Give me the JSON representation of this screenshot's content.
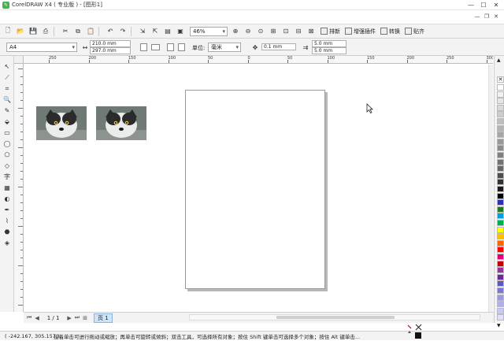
{
  "window": {
    "title": "CorelDRAW X4 ( 专业版 ) - [图形1]",
    "controls": [
      "minimize-icon",
      "maximize-icon",
      "close-icon"
    ]
  },
  "toolbar_standard": {
    "zoom_value": "46%",
    "buttons": [
      {
        "label": "排新"
      },
      {
        "label": "增强插件"
      },
      {
        "label": "转换"
      },
      {
        "label": "贴齐"
      }
    ]
  },
  "property_bar": {
    "page_size": "A4",
    "width": "210.0 mm",
    "height": "297.0 mm",
    "units_label": "单位:",
    "units_value": "毫米",
    "nudge_value": "0.1 mm",
    "dup_x": "5.0 mm",
    "dup_y": "5.0 mm"
  },
  "ruler": {
    "h_ticks": [
      "250",
      "200",
      "150",
      "100",
      "50",
      "0",
      "50",
      "100",
      "150",
      "200",
      "250",
      "300"
    ]
  },
  "page_nav": {
    "page_count": "1 / 1",
    "tab_label": "页 1"
  },
  "status": {
    "coords": "( -242.167, 305.157 )",
    "message": "接着单击可进行拖动或缩放；再单击可旋转或倾斜；双击工具，可选择所有对象；按住 Shift 键单击可选择多个对象；按住 Alt 键单击..."
  },
  "palette": {
    "colors": [
      "#ffffff",
      "#f2f2f2",
      "#e6e6e6",
      "#d9d9d9",
      "#cccccc",
      "#bfbfbf",
      "#b3b3b3",
      "#a6a6a6",
      "#999999",
      "#8c8c8c",
      "#808080",
      "#737373",
      "#666666",
      "#4d4d4d",
      "#333333",
      "#1a1a1a",
      "#000000",
      "#2e2eb8",
      "#1f7a1f",
      "#00a0e0",
      "#00b050",
      "#ffff00",
      "#ffc000",
      "#ff6600",
      "#ff0000",
      "#e0007a",
      "#c00000",
      "#993399",
      "#6a2c91",
      "#5a5ab4",
      "#7a7ad0",
      "#9a9ae0",
      "#b0b0ea",
      "#c8c8f2",
      "#e0e0fa"
    ]
  }
}
